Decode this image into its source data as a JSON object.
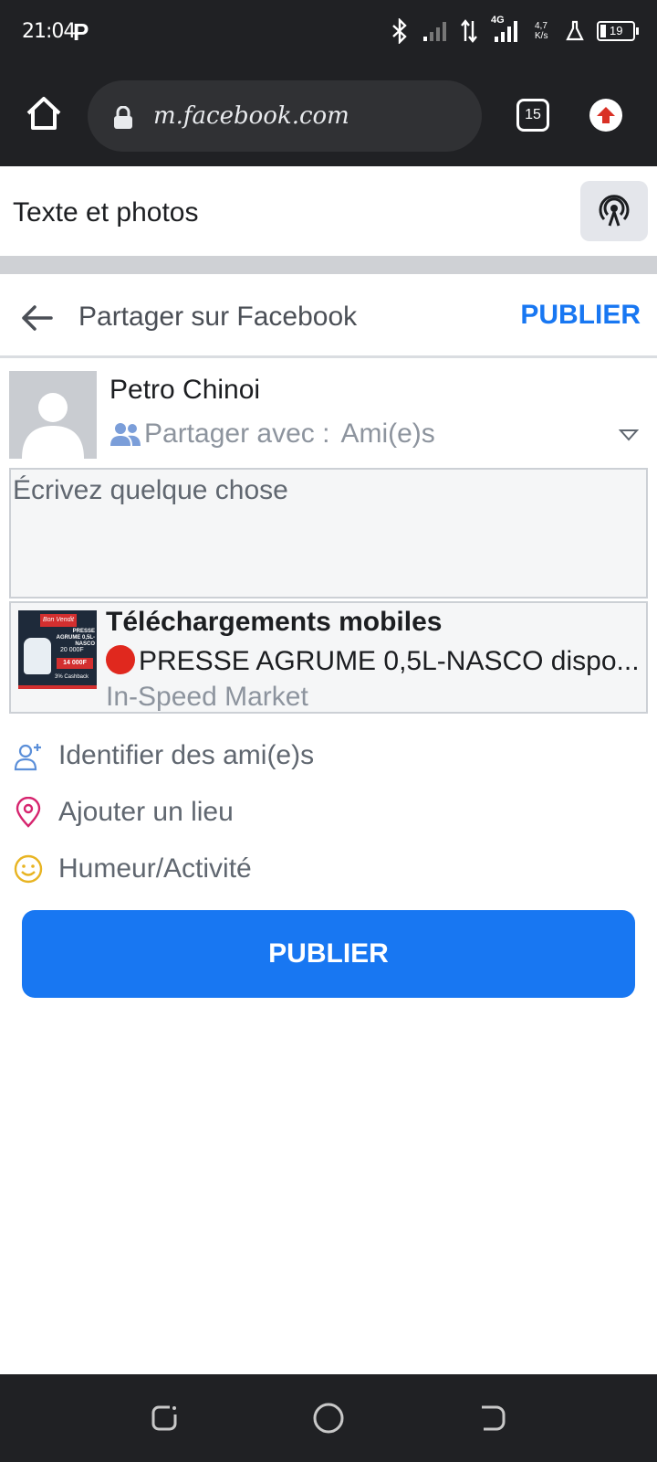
{
  "status_bar": {
    "time": "21:04",
    "app_letter": "P",
    "network": "4G",
    "speed": "4,7 K/s",
    "battery": "19"
  },
  "browser": {
    "url": "m.facebook.com",
    "tab_count": "15"
  },
  "section": {
    "title": "Texte et photos"
  },
  "share": {
    "title": "Partager sur Facebook",
    "publish_label": "PUBLIER"
  },
  "author": {
    "name": "Petro Chinoi",
    "audience_label": "Partager avec :",
    "audience_value": "Ami(e)s"
  },
  "composer": {
    "placeholder": "Écrivez quelque chose"
  },
  "preview": {
    "title": "Téléchargements mobiles",
    "description": "PRESSE AGRUME 0,5L-NASCO dispo...",
    "source": "In-Speed Market",
    "thumb": {
      "banner": "Bon Vendit",
      "product": "PRESSE AGRUME 0,5L-NASCO",
      "old_price": "20 000F",
      "new_price": "14 000F",
      "footer": "3% Cashback"
    }
  },
  "actions": [
    {
      "label": "Identifier des ami(e)s",
      "icon": "add-friend-icon"
    },
    {
      "label": "Ajouter un lieu",
      "icon": "location-pin-icon"
    },
    {
      "label": "Humeur/Activité",
      "icon": "smiley-icon"
    }
  ],
  "publish_button": {
    "label": "PUBLIER"
  },
  "colors": {
    "accent": "#1877f2",
    "status_bar": "#202124"
  }
}
